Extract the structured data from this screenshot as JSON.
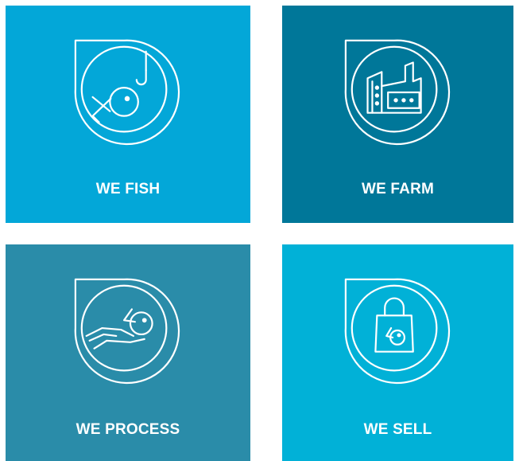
{
  "tiles": [
    {
      "label": "WE FISH",
      "icon": "fish-on-hook-icon",
      "color": "#03a7d8"
    },
    {
      "label": "WE FARM",
      "icon": "fish-factory-icon",
      "color": "#007799"
    },
    {
      "label": "WE PROCESS",
      "icon": "hand-holding-fish-icon",
      "color": "#2a8ca9"
    },
    {
      "label": "WE SELL",
      "icon": "shopping-bag-icon",
      "color": "#01b1d7"
    }
  ]
}
